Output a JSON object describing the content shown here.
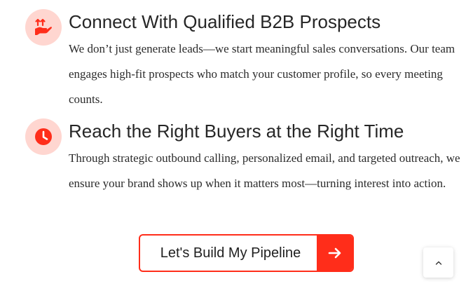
{
  "colors": {
    "accent": "#ff2d1a",
    "icon_bg": "#ffd6d0",
    "heading": "#262626",
    "body": "#2b2b2b"
  },
  "features": [
    {
      "icon": "hand-arrows-icon",
      "title": "Connect With Qualified B2B Prospects",
      "description": "We don’t just generate leads—we start meaningful sales conversations. Our team engages high-fit prospects who match your customer profile, so every meeting counts."
    },
    {
      "icon": "clock-icon",
      "title": "Reach the Right Buyers at the Right Time",
      "description": "Through strategic outbound calling, personalized email, and targeted outreach, we ensure your brand shows up when it matters most—turning interest into action."
    }
  ],
  "cta": {
    "label": "Let's Build My Pipeline",
    "icon": "arrow-right-icon"
  },
  "back_to_top": {
    "icon": "chevron-up-icon"
  }
}
